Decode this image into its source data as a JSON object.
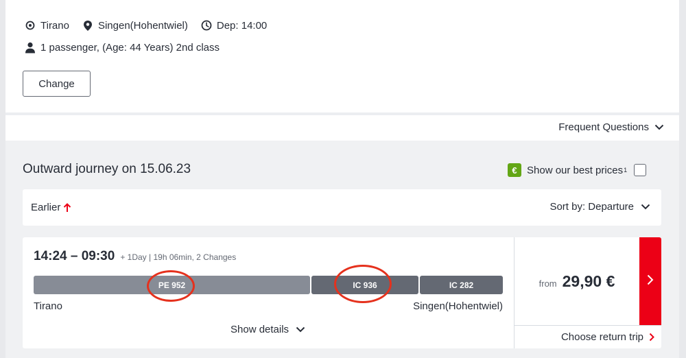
{
  "search": {
    "origin": "Tirano",
    "destination": "Singen(Hohentwiel)",
    "departure": "Dep: 14:00",
    "passengers": "1 passenger, (Age: 44 Years) 2nd class",
    "change_label": "Change"
  },
  "faq_label": "Frequent Questions",
  "journey": {
    "title": "Outward journey on 15.06.23",
    "best_prices_label": "Show our best prices",
    "best_prices_footnote": "1",
    "best_prices_checked": false,
    "earlier_label": "Earlier",
    "sort_label": "Sort by: Departure"
  },
  "connection": {
    "times": "14:24 – 09:30",
    "meta": "+ 1Day | 19h 06min, 2 Changes",
    "segments": [
      "PE 952",
      "IC 936",
      "IC 282"
    ],
    "from_station": "Tirano",
    "to_station": "Singen(Hohentwiel)",
    "details_label": "Show details",
    "price_from": "from",
    "price": "29,90 €",
    "return_label": "Choose return trip"
  },
  "colors": {
    "accent_red": "#ec0016",
    "best_price_green": "#63a615",
    "annotation_red": "#e5311d"
  },
  "icons": [
    "origin-icon",
    "location-pin-icon",
    "clock-icon",
    "person-icon",
    "chevron-down-icon",
    "arrow-up-icon",
    "euro-icon",
    "chevron-right-icon"
  ]
}
